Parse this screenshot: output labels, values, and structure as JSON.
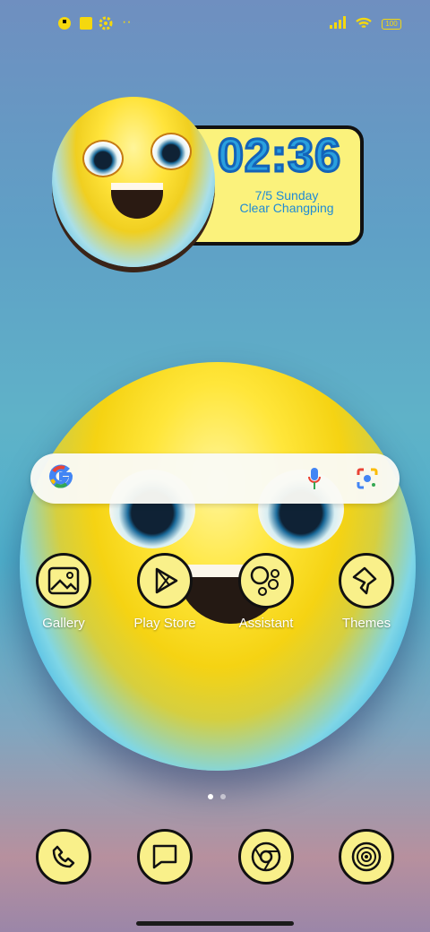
{
  "status_bar": {
    "left_icons": [
      "tile-icon",
      "square-icon",
      "gear-icon",
      "more-icon"
    ],
    "battery": "100"
  },
  "clock_widget": {
    "time": "02:36",
    "date": "7/5  Sunday",
    "weather": "Clear Changping"
  },
  "search": {
    "icons": [
      "google-logo",
      "mic-icon",
      "lens-icon"
    ]
  },
  "apps": [
    {
      "label": "Gallery",
      "icon": "gallery-icon"
    },
    {
      "label": "Play Store",
      "icon": "play-store-icon"
    },
    {
      "label": "Assistant",
      "icon": "assistant-icon"
    },
    {
      "label": "Themes",
      "icon": "themes-icon"
    }
  ],
  "dock": [
    {
      "icon": "phone-icon"
    },
    {
      "icon": "messages-icon"
    },
    {
      "icon": "chrome-icon"
    },
    {
      "icon": "camera-icon"
    }
  ],
  "page_indicator": {
    "pages": 2,
    "active": 1
  }
}
